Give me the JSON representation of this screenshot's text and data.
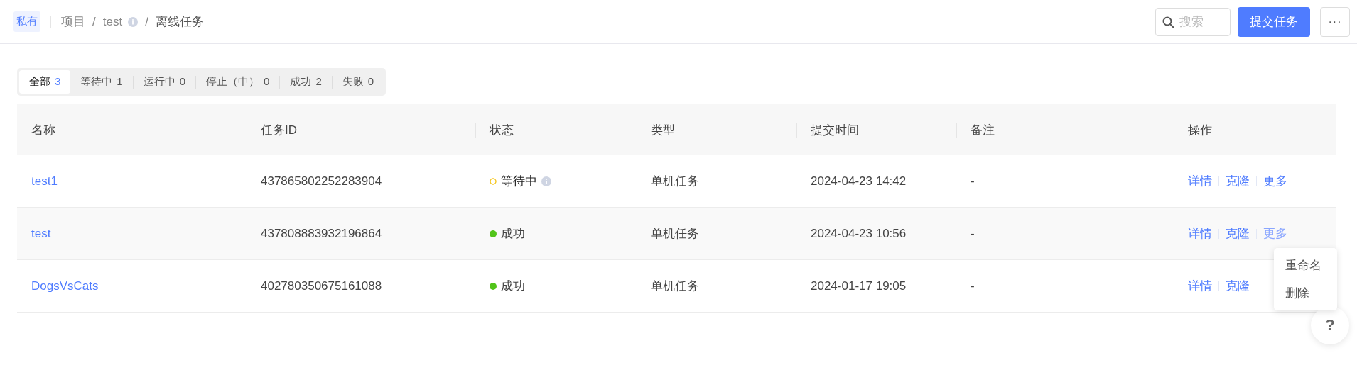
{
  "header": {
    "badge": "私有",
    "breadcrumb_separator": "/",
    "breadcrumb": [
      {
        "label": "项目",
        "info": false
      },
      {
        "label": "test",
        "info": true
      },
      {
        "label": "离线任务",
        "info": false
      }
    ],
    "search": {
      "placeholder": "搜索"
    },
    "submit_button": "提交任务",
    "more_button": "···"
  },
  "tabs": [
    {
      "label": "全部",
      "count": "3",
      "selected": true
    },
    {
      "label": "等待中",
      "count": "1",
      "selected": false
    },
    {
      "label": "运行中",
      "count": "0",
      "selected": false
    },
    {
      "label": "停止（中）",
      "count": "0",
      "selected": false
    },
    {
      "label": "成功",
      "count": "2",
      "selected": false
    },
    {
      "label": "失败",
      "count": "0",
      "selected": false
    }
  ],
  "table": {
    "columns": [
      "名称",
      "任务ID",
      "状态",
      "类型",
      "提交时间",
      "备注",
      "操作"
    ],
    "rows": [
      {
        "name": "test1",
        "id": "437865802252283904",
        "status": {
          "kind": "waiting",
          "label": "等待中"
        },
        "type": "单机任务",
        "time": "2024-04-23 14:42",
        "note": "-",
        "actions": [
          "详情",
          "克隆",
          "更多"
        ],
        "hovered": false
      },
      {
        "name": "test",
        "id": "437808883932196864",
        "status": {
          "kind": "success",
          "label": "成功"
        },
        "type": "单机任务",
        "time": "2024-04-23 10:56",
        "note": "-",
        "actions": [
          "详情",
          "克隆",
          "更多"
        ],
        "hovered": true
      },
      {
        "name": "DogsVsCats",
        "id": "402780350675161088",
        "status": {
          "kind": "success",
          "label": "成功"
        },
        "type": "单机任务",
        "time": "2024-01-17 19:05",
        "note": "-",
        "actions": [
          "详情",
          "克隆"
        ],
        "hovered": false
      }
    ]
  },
  "menu": {
    "items": [
      "重命名",
      "删除"
    ]
  },
  "help_button": "?"
}
